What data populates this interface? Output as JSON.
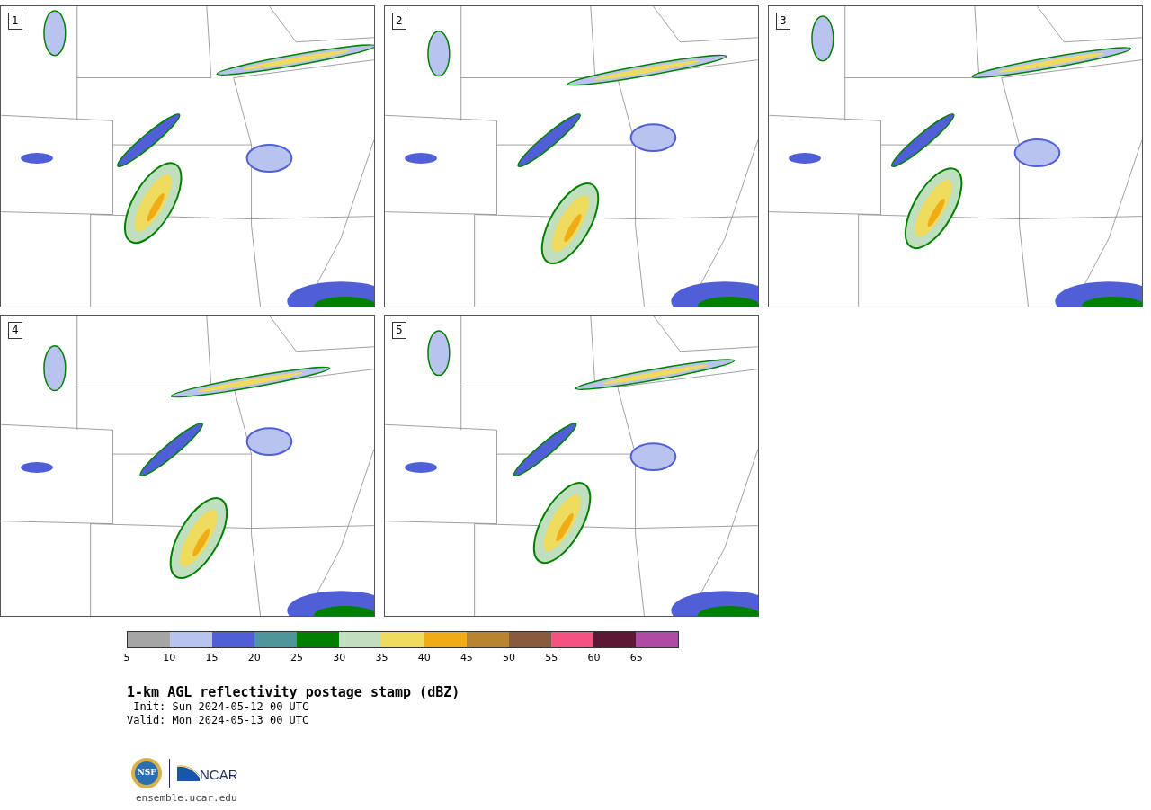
{
  "panels": [
    {
      "number": "1"
    },
    {
      "number": "2"
    },
    {
      "number": "3"
    },
    {
      "number": "4"
    },
    {
      "number": "5"
    }
  ],
  "colorbar": {
    "segments": [
      {
        "color": "#a5a5a5"
      },
      {
        "color": "#b8c3ef"
      },
      {
        "color": "#505fd6"
      },
      {
        "color": "#4f969b"
      },
      {
        "color": "#008000"
      },
      {
        "color": "#bfdfbf"
      },
      {
        "color": "#efdb5e"
      },
      {
        "color": "#efac16"
      },
      {
        "color": "#b98430"
      },
      {
        "color": "#8a5a3e"
      },
      {
        "color": "#f55181"
      },
      {
        "color": "#5f1736"
      },
      {
        "color": "#ad4aa3"
      }
    ],
    "ticks": [
      "5",
      "10",
      "15",
      "20",
      "25",
      "30",
      "35",
      "40",
      "45",
      "50",
      "55",
      "60",
      "65"
    ]
  },
  "title": "1-km AGL reflectivity postage stamp (dBZ)",
  "init": " Init: Sun 2024-05-12 00 UTC",
  "valid": "Valid: Mon 2024-05-13 00 UTC",
  "logos": {
    "nsf": "NSF",
    "ncar": "NCAR"
  },
  "site": "ensemble.ucar.edu"
}
